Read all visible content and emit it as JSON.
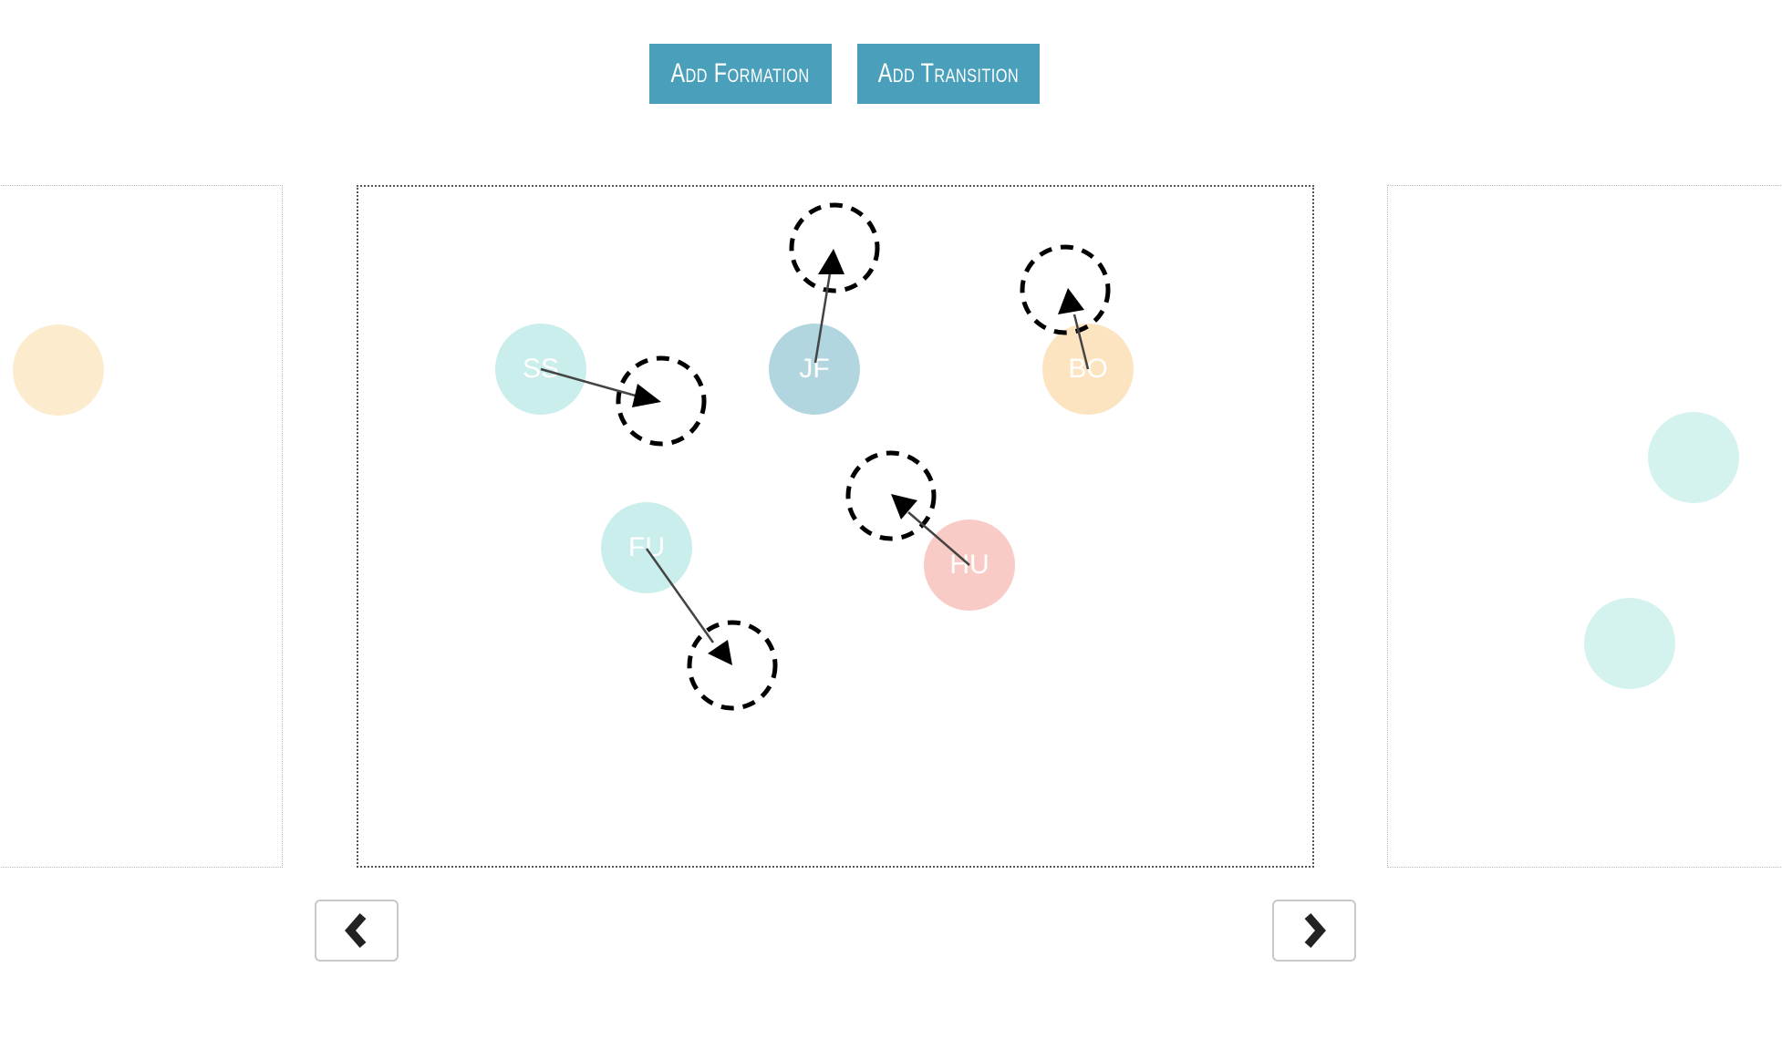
{
  "toolbar": {
    "add_formation_label": "Add Formation",
    "add_transition_label": "Add Transition"
  },
  "colors": {
    "button_bg": "#4a9fbb",
    "teal": "#c9eeeb",
    "blue": "#b2d6e0",
    "orange": "#fde4c0",
    "pink": "#f9cbc6"
  },
  "current_formation": {
    "dancers": [
      {
        "initials": "SS",
        "color": "#c9eeeb"
      },
      {
        "initials": "JF",
        "color": "#b2d6e0"
      },
      {
        "initials": "BO",
        "color": "#fde4c0"
      },
      {
        "initials": "FU",
        "color": "#c9eeeb"
      },
      {
        "initials": "HU",
        "color": "#f9cbc6"
      }
    ]
  },
  "navigation": {
    "prev_icon": "chevron-left-icon",
    "next_icon": "chevron-right-icon"
  }
}
